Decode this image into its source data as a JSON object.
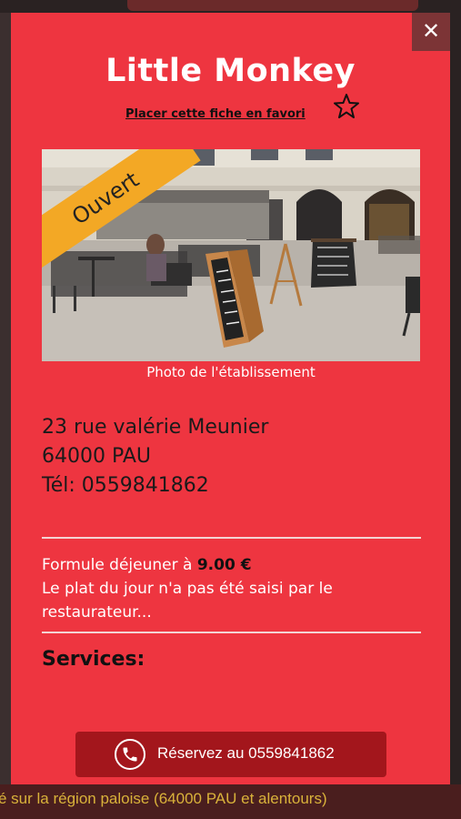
{
  "background": {
    "ticker_text": "é sur la région paloise (64000 PAU et alentours)"
  },
  "modal": {
    "close_symbol": "✕",
    "title": "Little Monkey",
    "favorite_label": "Placer cette fiche en favori",
    "favorite_icon": "star-outline-icon",
    "status_ribbon": "Ouvert",
    "photo_caption": "Photo de l'établissement",
    "address": {
      "street": "23 rue valérie Meunier",
      "city": "64000 PAU",
      "phone": "Tél: 0559841862"
    },
    "formula": {
      "prefix": "Formule déjeuner à ",
      "price": "9.00 €",
      "dish_note": "Le plat du jour n'a pas été saisi par le restaurateur..."
    },
    "services_heading": "Services:",
    "reserve": {
      "icon": "phone-icon",
      "label": "Réservez au 0559841862"
    }
  },
  "colors": {
    "modal_bg": "#ee3540",
    "ribbon": "#f3a825",
    "reserve_button": "#a3161c",
    "close_button": "#7c3436"
  }
}
